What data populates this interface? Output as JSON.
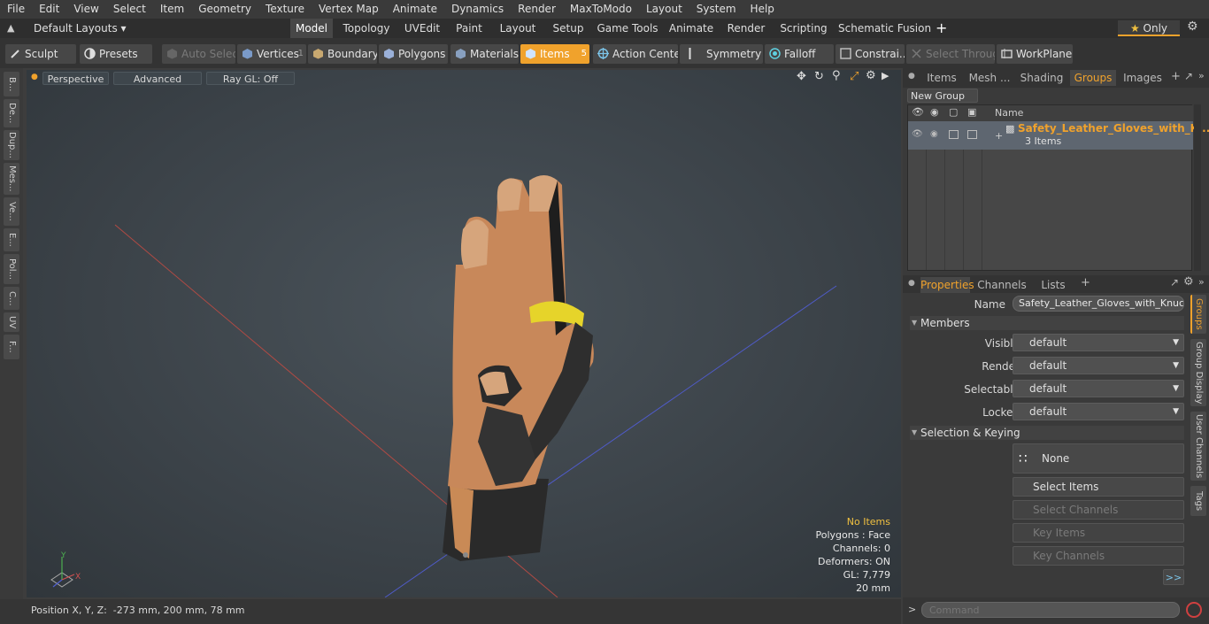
{
  "menu": [
    "File",
    "Edit",
    "View",
    "Select",
    "Item",
    "Geometry",
    "Texture",
    "Vertex Map",
    "Animate",
    "Dynamics",
    "Render",
    "MaxToModo",
    "Layout",
    "System",
    "Help"
  ],
  "layout_selector": "Default Layouts",
  "layout_tabs": [
    "Model",
    "Topology",
    "UVEdit",
    "Paint",
    "Layout",
    "Setup",
    "Game Tools",
    "Animate",
    "Render",
    "Scripting",
    "Schematic Fusion"
  ],
  "only_label": "Only",
  "toolbar": {
    "sculpt": "Sculpt",
    "presets": "Presets",
    "auto_select": "Auto Select",
    "vertices": "Vertices",
    "vertices_count": "1",
    "boundary": "Boundary",
    "polygons": "Polygons",
    "materials": "Materials",
    "items": "Items",
    "items_count": "5",
    "action_center": "Action Center",
    "symmetry": "Symmetry",
    "falloff": "Falloff",
    "constraints": "Constrai...",
    "select_through": "Select Through",
    "workplane": "WorkPlane"
  },
  "left_tabs": [
    "B...",
    "De...",
    "Dup...",
    "Mes...",
    "Ve...",
    "E...",
    "Pol...",
    "C...",
    "UV",
    "F..."
  ],
  "viewport": {
    "perspective": "Perspective",
    "advanced": "Advanced",
    "raygl": "Ray GL: Off",
    "stats": {
      "no_items": "No Items",
      "polygons": "Polygons : Face",
      "channels": "Channels: 0",
      "deformers": "Deformers: ON",
      "gl": "GL: 7,779",
      "scale": "20 mm"
    },
    "colors": {
      "no_items": "#f0c040",
      "accent": "#f0a22c"
    }
  },
  "status": {
    "position": "Position X, Y, Z:  -273 mm, 200 mm, 78 mm"
  },
  "right_top_tabs": [
    "Items",
    "Mesh ...",
    "Shading",
    "Groups",
    "Images"
  ],
  "groups": {
    "new_group": "New Group",
    "col_name": "Name",
    "item_name": "Safety_Leather_Gloves_with_K ...",
    "item_count": "3 Items"
  },
  "props_tabs": [
    "Properties",
    "Channels",
    "Lists"
  ],
  "props": {
    "name_label": "Name",
    "name_value": "Safety_Leather_Gloves_with_Knuckle",
    "members": "Members",
    "visible_label": "Visible",
    "render_label": "Render",
    "selectable_label": "Selectable",
    "locked_label": "Locked",
    "default": "default",
    "selection_keying": "Selection & Keying",
    "none": "None",
    "select_items": "Select Items",
    "select_channels": "Select Channels",
    "key_items": "Key Items",
    "key_channels": "Key Channels",
    "more": ">>"
  },
  "side_vtabs": [
    "Groups",
    "Group Display",
    "User Channels",
    "Tags"
  ],
  "command_placeholder": "Command"
}
